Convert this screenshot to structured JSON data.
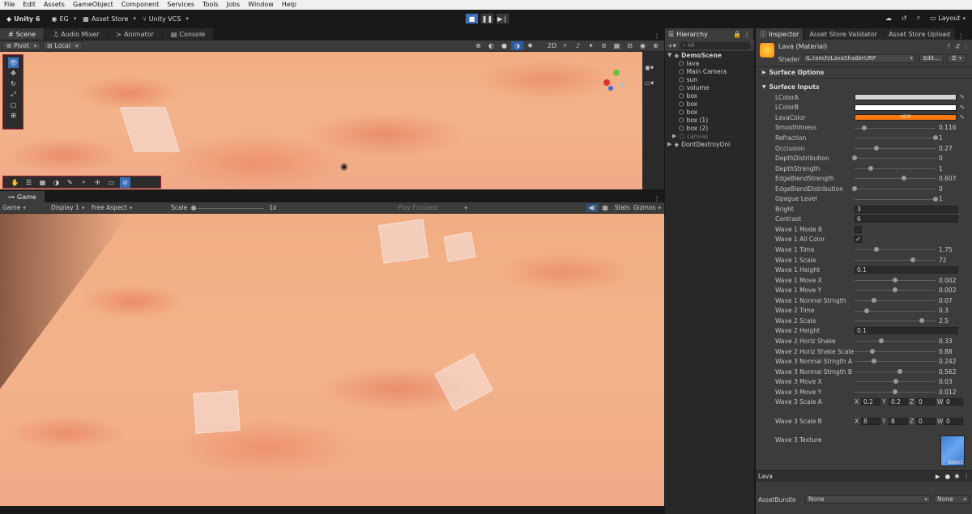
{
  "menu": [
    "File",
    "Edit",
    "Assets",
    "GameObject",
    "Component",
    "Services",
    "Tools",
    "Jobs",
    "Window",
    "Help"
  ],
  "toolbar": {
    "unity_label": "Unity 6",
    "account": "EG",
    "asset_store": "Asset Store",
    "vcs": "Unity VCS",
    "layout": "Layout"
  },
  "scene_tabs": [
    "Scene",
    "Audio Mixer",
    "Animator",
    "Console"
  ],
  "scene_bar": {
    "pivot": "Pivot",
    "local": "Local"
  },
  "game_tab": "Game",
  "game_bar": {
    "display_mode": "Game",
    "display": "Display 1",
    "aspect": "Free Aspect",
    "scale_label": "Scale",
    "scale_value": "1x",
    "play_focused": "Play Focused",
    "stats": "Stats",
    "gizmos": "Gizmos"
  },
  "hierarchy": {
    "title": "Hierarchy",
    "search": "All",
    "scene": "DemoScene",
    "items": [
      "lava",
      "Main Camera",
      "sun",
      "volume",
      "box",
      "box",
      "box",
      "box (1)",
      "box (2)",
      "canvas"
    ],
    "dont_destroy": "DontDestroyOnl"
  },
  "inspector_tabs": [
    "Inspector",
    "Asset Store Validator",
    "Asset Store Upload"
  ],
  "material": {
    "name": "Lava (Material)",
    "shader_label": "Shader",
    "shader": "IL.ranch/LavaShaderURP",
    "edit": "Edit..."
  },
  "sections": {
    "surface_options": "Surface Options",
    "surface_inputs": "Surface Inputs"
  },
  "colors": [
    {
      "label": "LColorA",
      "color": "#d4d4d4"
    },
    {
      "label": "LColorB",
      "color": "#ffffff"
    },
    {
      "label": "LavaColor",
      "color": "#ff7a10",
      "badge": "HDR"
    }
  ],
  "sliders": [
    {
      "label": "Smoothhness",
      "value": "0.116",
      "pos": 0.12
    },
    {
      "label": "Refraction",
      "value": "1",
      "pos": 1.0
    },
    {
      "label": "Occlusion",
      "value": "0.27",
      "pos": 0.27
    },
    {
      "label": "DepthDistribution",
      "value": "0",
      "pos": 0.0
    },
    {
      "label": "DepthStrength",
      "value": "1",
      "pos": 0.2
    },
    {
      "label": "EdgeBlendStrength",
      "value": "0.607",
      "pos": 0.61
    },
    {
      "label": "EdgeBlendDistribution",
      "value": "0",
      "pos": 0.0
    },
    {
      "label": "Opague Level",
      "value": "1",
      "pos": 1.0
    }
  ],
  "fields": [
    {
      "label": "Bright",
      "value": "3"
    },
    {
      "label": "Contrast",
      "value": "6"
    }
  ],
  "toggles": [
    {
      "label": "Wave 1 Mode B",
      "checked": ""
    },
    {
      "label": "Wave 1 All Color",
      "checked": "✓"
    }
  ],
  "wave_sliders_a": [
    {
      "label": "Wave 1 Time",
      "value": "1.75",
      "pos": 0.27
    },
    {
      "label": "Wave 1 Scale",
      "value": "72",
      "pos": 0.72
    }
  ],
  "wave1_height": {
    "label": "Wave 1 Height",
    "value": "0.1"
  },
  "wave_sliders_b": [
    {
      "label": "Wave 1 Move X",
      "value": "0.002",
      "pos": 0.5
    },
    {
      "label": "Wave 1 Move Y",
      "value": "0.002",
      "pos": 0.5
    },
    {
      "label": "Wave 1 Normal Strngth",
      "value": "0.07",
      "pos": 0.24
    },
    {
      "label": "Wave 2 Time",
      "value": "0.3",
      "pos": 0.15
    },
    {
      "label": "Wave 2 Scale",
      "value": "2.5",
      "pos": 0.83
    }
  ],
  "wave2_height": {
    "label": "Wave 2 Height",
    "value": "0.1"
  },
  "wave_sliders_c": [
    {
      "label": "Wave 2 Horiz Shake",
      "value": "0.33",
      "pos": 0.33
    },
    {
      "label": "Wave 2 Horiz Shake Scale",
      "value": "0.88",
      "pos": 0.22
    },
    {
      "label": "Wave 3 Normal Strngth A",
      "value": "0.242",
      "pos": 0.24
    },
    {
      "label": "Wave 3 Normal Strngth B",
      "value": "0.562",
      "pos": 0.56
    },
    {
      "label": "Wave 3 Move X",
      "value": "0.03",
      "pos": 0.51
    },
    {
      "label": "Wave 3 Move Y",
      "value": "0.012",
      "pos": 0.5
    }
  ],
  "wave3_scale_a": {
    "label": "Wave 3 Scale A",
    "x": "0.2",
    "y": "0.2",
    "z": "0",
    "w": "0"
  },
  "wave3_scale_b": {
    "label": "Wave 3 Scale B",
    "x": "8",
    "y": "8",
    "z": "0",
    "w": "0"
  },
  "wave3_texture": {
    "label": "Wave 3 Texture",
    "select": "Select"
  },
  "footer": {
    "name": "Lava",
    "assetbundle_label": "AssetBundle",
    "assetbundle": "None",
    "variant": "None"
  }
}
